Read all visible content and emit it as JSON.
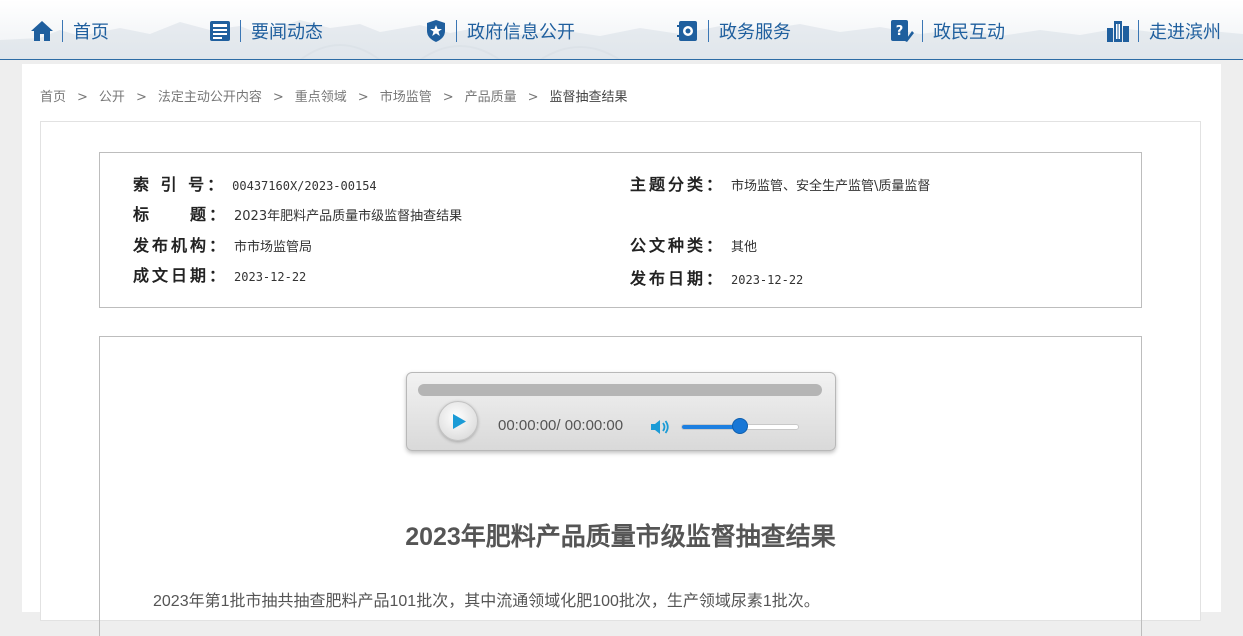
{
  "nav": {
    "items": [
      {
        "label": "首页",
        "icon": "home-icon"
      },
      {
        "label": "要闻动态",
        "icon": "news-icon"
      },
      {
        "label": "政府信息公开",
        "icon": "badge-icon"
      },
      {
        "label": "政务服务",
        "icon": "service-book-icon"
      },
      {
        "label": "政民互动",
        "icon": "chat-edit-icon"
      },
      {
        "label": "走进滨州",
        "icon": "buildings-icon"
      }
    ],
    "color": "#1f5f9e",
    "bar_color": "#2d6ca5"
  },
  "breadcrumb": [
    "首页",
    "公开",
    "法定主动公开内容",
    "重点领域",
    "市场监管",
    "产品质量",
    "监督抽查结果"
  ],
  "meta": {
    "index_label": "索 引 号：",
    "index_value": "00437160X/2023-00154",
    "topic_label": "主题分类：",
    "topic_value": "市场监管、安全生产监管\\质量监督",
    "title_label": "标　　题：",
    "title_value": "2023年肥料产品质量市级监督抽查结果",
    "org_label": "发布机构：",
    "org_value": "市市场监管局",
    "doctype_label": "公文种类：",
    "doctype_value": "其他",
    "created_label": "成文日期：",
    "created_value": "2023-12-22",
    "published_label": "发布日期：",
    "published_value": "2023-12-22"
  },
  "player": {
    "time": "00:00:00/ 00:00:00",
    "progress": 0,
    "volume": 0.5
  },
  "article": {
    "title": "2023年肥料产品质量市级监督抽查结果",
    "body": "2023年第1批市抽共抽查肥料产品101批次，其中流通领域化肥100批次，生产领域尿素1批次。"
  }
}
